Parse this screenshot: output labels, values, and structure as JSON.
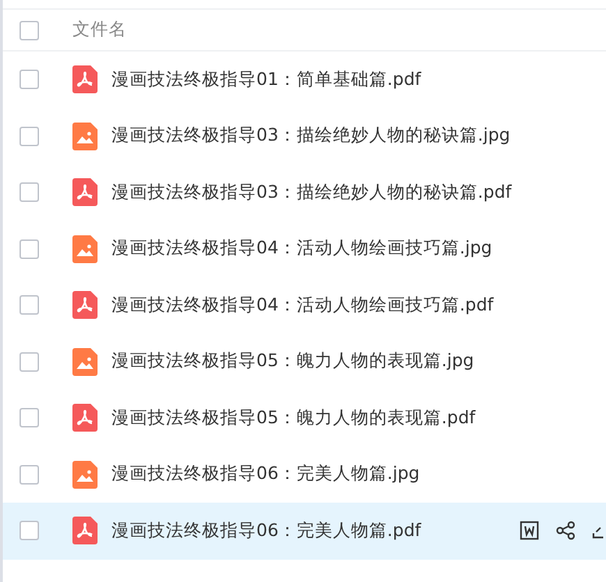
{
  "header": {
    "column_1": "文件名",
    "checked": false
  },
  "rows": [
    {
      "name": "漫画技法终极指导01：简单基础篇.pdf",
      "kind": "pdf",
      "checked": false,
      "selected": false
    },
    {
      "name": "漫画技法终极指导03：描绘绝妙人物的秘诀篇.jpg",
      "kind": "image",
      "checked": false,
      "selected": false
    },
    {
      "name": "漫画技法终极指导03：描绘绝妙人物的秘诀篇.pdf",
      "kind": "pdf",
      "checked": false,
      "selected": false
    },
    {
      "name": "漫画技法终极指导04：活动人物绘画技巧篇.jpg",
      "kind": "image",
      "checked": false,
      "selected": false
    },
    {
      "name": "漫画技法终极指导04：活动人物绘画技巧篇.pdf",
      "kind": "pdf",
      "checked": false,
      "selected": false
    },
    {
      "name": "漫画技法终极指导05：魄力人物的表现篇.jpg",
      "kind": "image",
      "checked": false,
      "selected": false
    },
    {
      "name": "漫画技法终极指导05：魄力人物的表现篇.pdf",
      "kind": "pdf",
      "checked": false,
      "selected": false
    },
    {
      "name": "漫画技法终极指导06：完美人物篇.jpg",
      "kind": "image",
      "checked": false,
      "selected": false
    },
    {
      "name": "漫画技法终极指导06：完美人物篇.pdf",
      "kind": "pdf",
      "checked": false,
      "selected": true
    }
  ]
}
